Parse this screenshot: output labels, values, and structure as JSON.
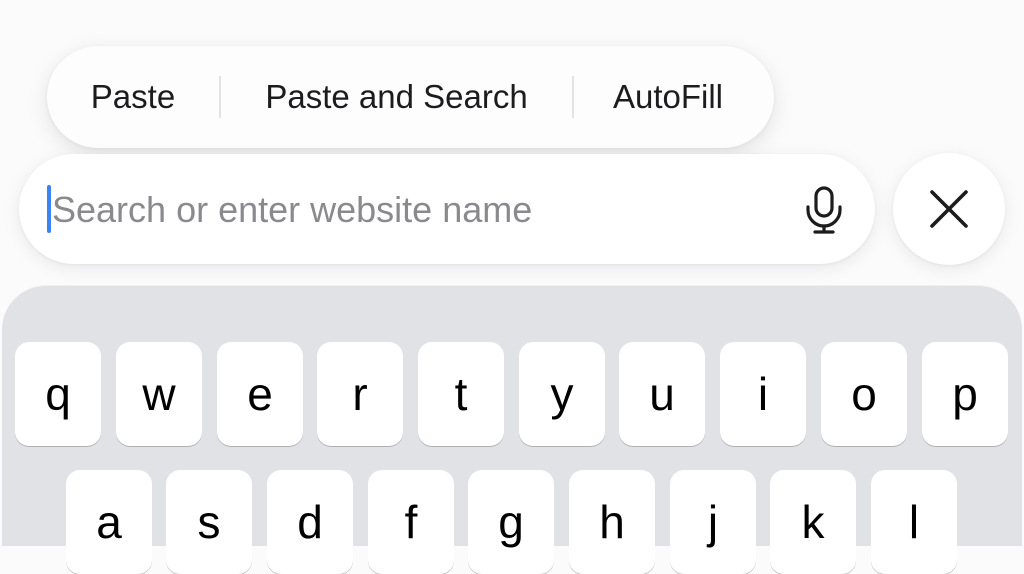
{
  "edit_menu": {
    "paste_label": "Paste",
    "paste_and_search_label": "Paste and Search",
    "autofill_label": "AutoFill"
  },
  "search": {
    "value": "",
    "placeholder": "Search or enter website name",
    "mic_icon": "microphone-icon"
  },
  "close_button": {
    "icon": "close-icon"
  },
  "keyboard": {
    "row1": [
      "q",
      "w",
      "e",
      "r",
      "t",
      "y",
      "u",
      "i",
      "o",
      "p"
    ],
    "row2": [
      "a",
      "s",
      "d",
      "f",
      "g",
      "h",
      "j",
      "k",
      "l"
    ]
  },
  "colors": {
    "caret": "#3b82f6",
    "keyboard_bg": "#e1e2e6",
    "key_bg": "#ffffff",
    "placeholder": "#8a8a8e"
  }
}
